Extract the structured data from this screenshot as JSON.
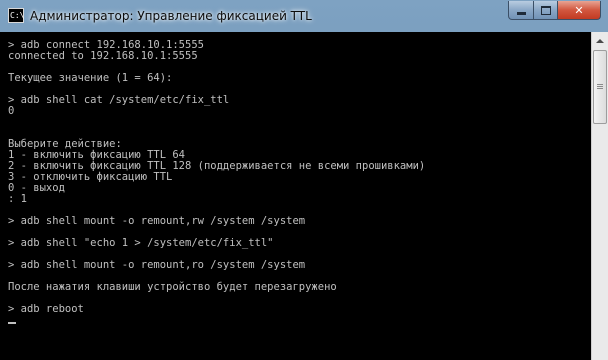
{
  "window": {
    "title": "Администратор:  Управление фиксацией TTL",
    "icon": "cmd-console-icon",
    "icon_glyph": "C:\\",
    "controls": {
      "minimize": "minimize-icon",
      "maximize": "maximize-icon",
      "close": "close-icon",
      "close_glyph": "✕"
    }
  },
  "console": {
    "lines": [
      "> adb connect 192.168.10.1:5555",
      "connected to 192.168.10.1:5555",
      "",
      "Текущее значение (1 = 64):",
      "",
      "> adb shell cat /system/etc/fix_ttl",
      "0",
      "",
      "",
      "Выберите действие:",
      "1 - включить фиксацию TTL 64",
      "2 - включить фиксацию TTL 128 (поддерживается не всеми прошивками)",
      "3 - отключить фиксацию TTL",
      "0 - выход",
      ": 1",
      "",
      "> adb shell mount -o remount,rw /system /system",
      "",
      "> adb shell \"echo 1 > /system/etc/fix_ttl\"",
      "",
      "> adb shell mount -o remount,ro /system /system",
      "",
      "После нажатия клавиши устройство будет перезагружено",
      "",
      "> adb reboot"
    ]
  },
  "colors": {
    "console_bg": "#000000",
    "console_text": "#c0c0c0",
    "close_button": "#c13a22"
  }
}
